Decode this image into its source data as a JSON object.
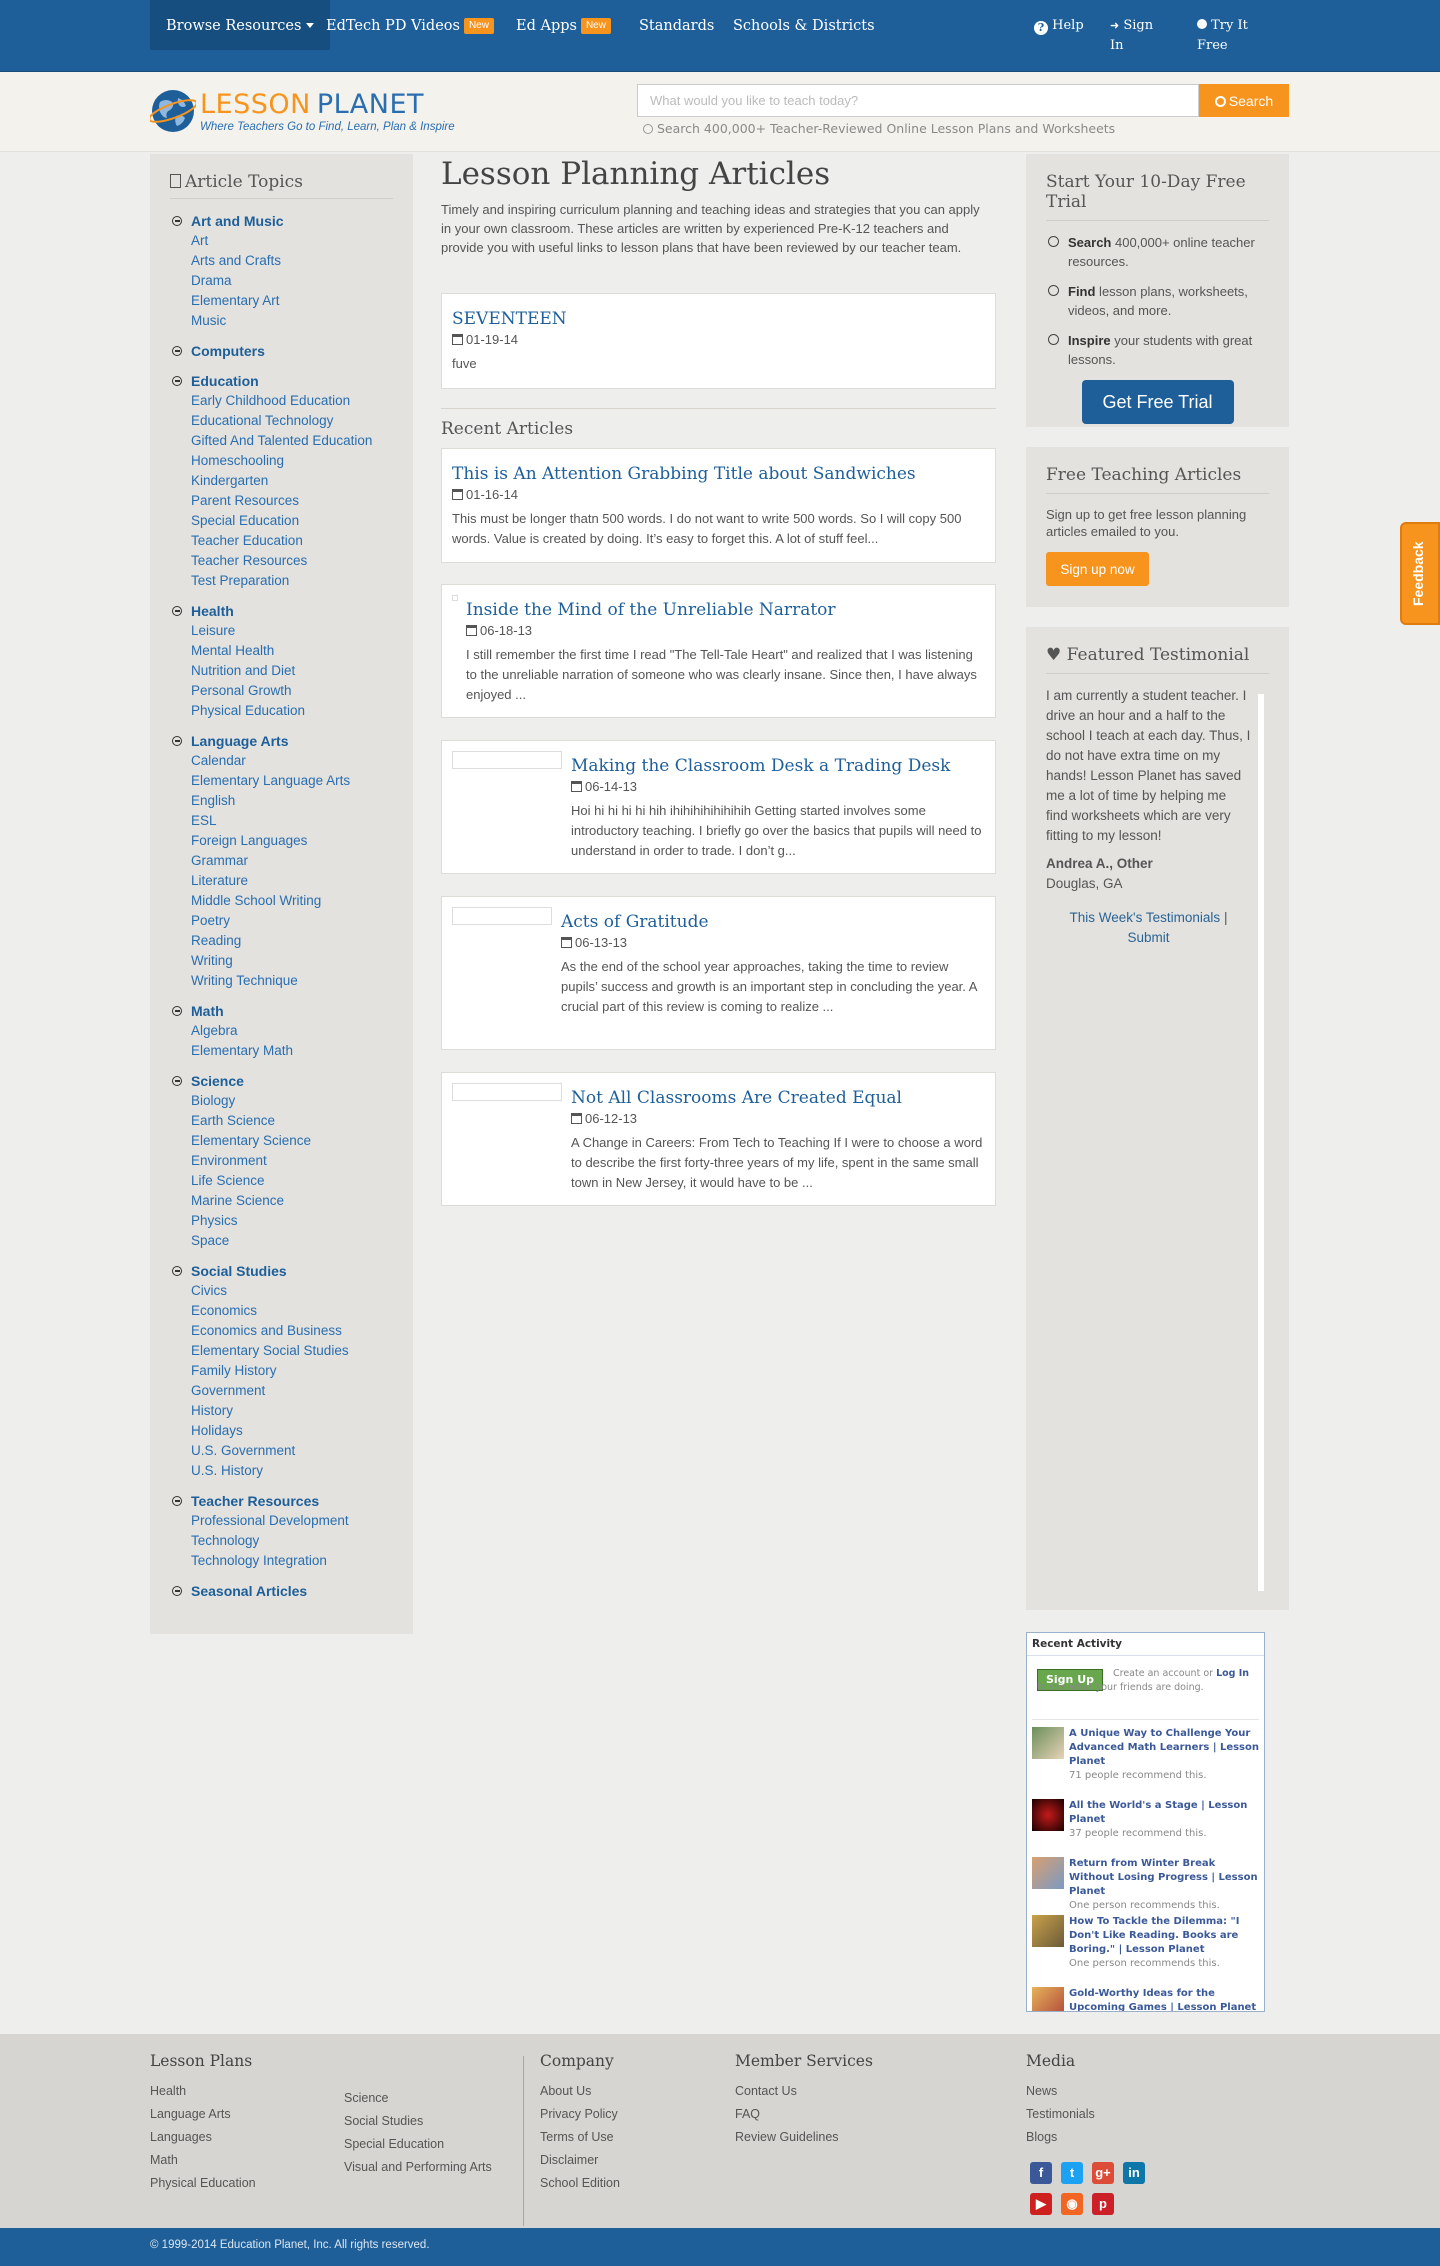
{
  "nav": {
    "browse": "Browse Resources",
    "edtech": "EdTech PD Videos",
    "edtech_badge": "New",
    "edapps": "Ed Apps",
    "edapps_badge": "New",
    "standards": "Standards",
    "schools": "Schools & Districts",
    "help": "Help",
    "signin": "Sign In",
    "try": "Try It Free"
  },
  "header": {
    "logo_lesson": "LESSON",
    "logo_planet": "PLANET",
    "logo_tagline": "Where Teachers Go to Find, Learn, Plan & Inspire",
    "search_placeholder": "What would you like to teach today?",
    "search_button": "Search",
    "search_hint": "Search 400,000+ Teacher-Reviewed Online Lesson Plans and Worksheets"
  },
  "sidebar": {
    "title": "Article Topics",
    "categories": [
      {
        "name": "Art and Music",
        "items": [
          "Art",
          "Arts and Crafts",
          "Drama",
          "Elementary Art",
          "Music"
        ]
      },
      {
        "name": "Computers",
        "items": []
      },
      {
        "name": "Education",
        "items": [
          "Early Childhood Education",
          "Educational Technology",
          "Gifted And Talented Education",
          "Homeschooling",
          "Kindergarten",
          "Parent Resources",
          "Special Education",
          "Teacher Education",
          "Teacher Resources",
          "Test Preparation"
        ]
      },
      {
        "name": "Health",
        "items": [
          "Leisure",
          "Mental Health",
          "Nutrition and Diet",
          "Personal Growth",
          "Physical Education"
        ]
      },
      {
        "name": "Language Arts",
        "items": [
          "Calendar",
          "Elementary Language Arts",
          "English",
          "ESL",
          "Foreign Languages",
          "Grammar",
          "Literature",
          "Middle School Writing",
          "Poetry",
          "Reading",
          "Writing",
          "Writing Technique"
        ]
      },
      {
        "name": "Math",
        "items": [
          "Algebra",
          "Elementary Math"
        ]
      },
      {
        "name": "Science",
        "items": [
          "Biology",
          "Earth Science",
          "Elementary Science",
          "Environment",
          "Life Science",
          "Marine Science",
          "Physics",
          "Space"
        ]
      },
      {
        "name": "Social Studies",
        "items": [
          "Civics",
          "Economics",
          "Economics and Business",
          "Elementary Social Studies",
          "Family History",
          "Government",
          "History",
          "Holidays",
          "U.S. Government",
          "U.S. History"
        ]
      },
      {
        "name": "Teacher Resources",
        "items": [
          "Professional Development",
          "Technology",
          "Technology Integration"
        ]
      },
      {
        "name": "Seasonal Articles",
        "items": []
      }
    ]
  },
  "main": {
    "title": "Lesson Planning Articles",
    "intro": "Timely and inspiring curriculum planning and teaching ideas and strategies that you can apply in your own classroom. These articles are written by experienced Pre-K-12 teachers and provide you with useful links to lesson plans that have been reviewed by our teacher team.",
    "featured": {
      "title": "SEVENTEEN",
      "date": "01-19-14",
      "text": "fuve"
    },
    "recent_title": "Recent Articles",
    "articles": [
      {
        "title": "This is An Attention Grabbing Title about Sandwiches",
        "date": "01-16-14",
        "text": "This must be longer thatn 500 words. I do not want to write 500 words. So I will copy 500 words.    Value is created by doing. It’s easy to forget this.  A lot of stuff feel..."
      },
      {
        "title": "Inside the Mind of the Unreliable Narrator",
        "date": "06-18-13",
        "text": "I still remember the first time I read \"The Tell-Tale Heart\" and realized that I was listening to the unreliable narration of someone who was clearly insane. Since then, I have always enjoyed ..."
      },
      {
        "title": "Making the Classroom Desk a Trading Desk",
        "date": "06-14-13",
        "text": "Hoi hi hi hi hi hih ihihihihihihihih   Getting started involves some introductory teaching. I briefly go over the basics that pupils will need to understand in order to trade. I don’t g..."
      },
      {
        "title": "Acts of Gratitude",
        "date": "06-13-13",
        "text": "As the end of the school year approaches, taking the time to review pupils’ success and growth is an important step in concluding the year. A crucial part of this review is coming to realize ..."
      },
      {
        "title": "Not All Classrooms Are Created Equal",
        "date": "06-12-13",
        "text": "A Change in Careers: From Tech to Teaching  If I were to choose a word to describe the first forty-three years of my life, spent in the same small town in New Jersey, it would have to be ..."
      }
    ]
  },
  "trial": {
    "title": "Start Your 10-Day Free Trial",
    "items": [
      {
        "bold": "Search",
        "text": " 400,000+ online teacher resources."
      },
      {
        "bold": "Find",
        "text": " lesson plans, worksheets, videos, and more."
      },
      {
        "bold": "Inspire",
        "text": " your students with great lessons."
      }
    ],
    "button": "Get Free Trial"
  },
  "free_articles": {
    "title": "Free Teaching Articles",
    "text": "Sign up to get free lesson planning articles emailed to you.",
    "button": "Sign up now"
  },
  "testimonial": {
    "title": "Featured Testimonial",
    "quote": "I am currently a student teacher. I drive an hour and a half to the school I teach at each day. Thus, I do not have extra time on my hands! Lesson Planet has saved me a lot of time by helping me find worksheets which are very fitting to my lesson!",
    "author": "Andrea A., Other",
    "location": "Douglas, GA",
    "link1": "This Week's Testimonials",
    "sep": "|",
    "link2": "Submit"
  },
  "fb": {
    "title": "Recent Activity",
    "signup": "Sign Up",
    "prompt_a": "Create an account or ",
    "prompt_login": "Log In",
    "prompt_b": " to see what your friends are doing.",
    "items": [
      {
        "title": "A Unique Way to Challenge Your Advanced Math Learners | Lesson Planet",
        "meta": "71 people recommend this."
      },
      {
        "title": "All the World's a Stage | Lesson Planet",
        "meta": "37 people recommend this."
      },
      {
        "title": "Return from Winter Break Without Losing Progress | Lesson Planet",
        "meta": "One person recommends this."
      },
      {
        "title": "How To Tackle the Dilemma: \"I Don't Like Reading. Books are Boring.\" | Lesson Planet",
        "meta": "One person recommends this."
      },
      {
        "title": "Gold-Worthy Ideas for the Upcoming Games | Lesson Planet",
        "meta": ""
      }
    ]
  },
  "feedback": "Feedback",
  "footer": {
    "lesson_plans": {
      "title": "Lesson Plans",
      "col1": [
        "Health",
        "Language Arts",
        "Languages",
        "Math",
        "Physical Education"
      ],
      "col2": [
        "Science",
        "Social Studies",
        "Special Education",
        "Visual and Performing Arts"
      ]
    },
    "company": {
      "title": "Company",
      "links": [
        "About Us",
        "Privacy Policy",
        "Terms of Use",
        "Disclaimer",
        "School Edition"
      ]
    },
    "member": {
      "title": "Member Services",
      "links": [
        "Contact Us",
        "FAQ",
        "Review Guidelines"
      ]
    },
    "media": {
      "title": "Media",
      "links": [
        "News",
        "Testimonials",
        "Blogs"
      ]
    },
    "social": [
      {
        "icon": "facebook-icon",
        "glyph": "f",
        "color": "#3b5998"
      },
      {
        "icon": "twitter-icon",
        "glyph": "t",
        "color": "#1da1f2"
      },
      {
        "icon": "google-plus-icon",
        "glyph": "g+",
        "color": "#dd4b39"
      },
      {
        "icon": "linkedin-icon",
        "glyph": "in",
        "color": "#0e76a8"
      },
      {
        "icon": "youtube-icon",
        "glyph": "▶",
        "color": "#cd201f"
      },
      {
        "icon": "rss-icon",
        "glyph": "◉",
        "color": "#f26522"
      },
      {
        "icon": "pinterest-icon",
        "glyph": "p",
        "color": "#cb2027"
      }
    ],
    "copyright": "© 1999-2014 Education Planet, Inc. All rights reserved."
  },
  "colors": {
    "brand_blue": "#1e5f99",
    "accent_orange": "#f7941d",
    "link_blue": "#2a6eb0"
  }
}
